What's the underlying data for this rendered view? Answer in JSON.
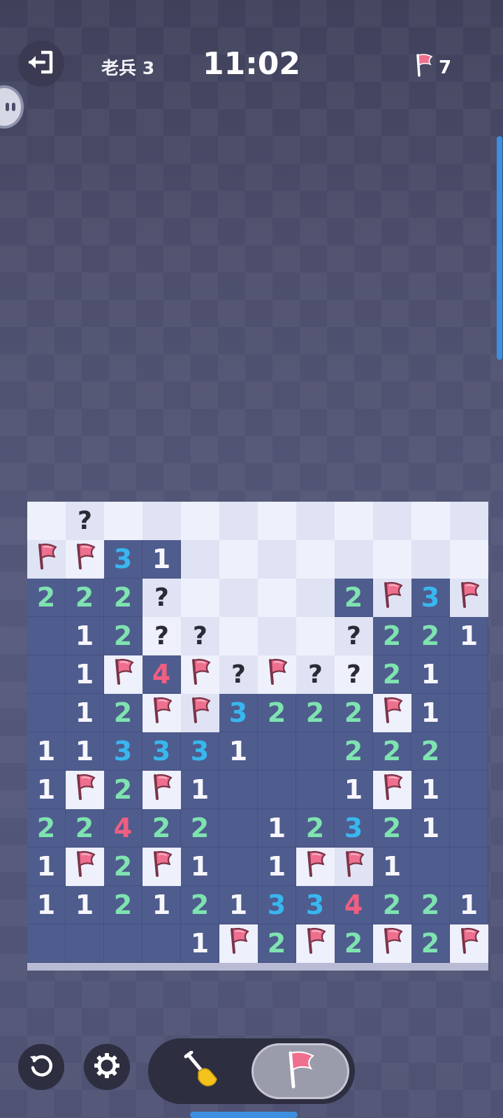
{
  "header": {
    "level": "老兵 3",
    "timer": "11:02",
    "flags_remaining": "7"
  },
  "icons": {
    "exit": "exit-icon",
    "flag": "flag-icon",
    "undo": "undo-icon",
    "settings": "gear-icon",
    "shovel": "shovel-icon"
  },
  "colors": {
    "num1": "#f6f6fb",
    "num2": "#7ee3b0",
    "num3": "#38b7ef",
    "num4": "#ef5f82",
    "flag": "#ef6f8e"
  },
  "tools": {
    "selected": "flag"
  },
  "board": {
    "rows": [
      [
        "H",
        "?",
        "H",
        "H",
        "H",
        "H",
        "H",
        "H",
        "H",
        "H",
        "H",
        "H"
      ],
      [
        "F",
        "F",
        "3",
        "1",
        "H",
        "H",
        "H",
        "H",
        "H",
        "H",
        "H",
        "H"
      ],
      [
        "2",
        "2",
        "2",
        "?",
        "H",
        "H",
        "H",
        "H",
        "2",
        "F",
        "3",
        "F"
      ],
      [
        "0",
        "1",
        "2",
        "?",
        "?",
        "H",
        "H",
        "H",
        "?",
        "2",
        "2",
        "1"
      ],
      [
        "0",
        "1",
        "F",
        "4",
        "F",
        "?",
        "F",
        "?",
        "?",
        "2",
        "1",
        "0"
      ],
      [
        "0",
        "1",
        "2",
        "F",
        "F",
        "3",
        "2",
        "2",
        "2",
        "F",
        "1",
        "0"
      ],
      [
        "1",
        "1",
        "3",
        "3",
        "3",
        "1",
        "0",
        "0",
        "2",
        "2",
        "2",
        "0"
      ],
      [
        "1",
        "F",
        "2",
        "F",
        "1",
        "0",
        "0",
        "0",
        "1",
        "F",
        "1",
        "0"
      ],
      [
        "2",
        "2",
        "4",
        "2",
        "2",
        "0",
        "1",
        "2",
        "3",
        "2",
        "1",
        "0"
      ],
      [
        "1",
        "F",
        "2",
        "F",
        "1",
        "0",
        "1",
        "F",
        "F",
        "1",
        "0",
        "0"
      ],
      [
        "1",
        "1",
        "2",
        "1",
        "2",
        "1",
        "3",
        "3",
        "4",
        "2",
        "2",
        "1"
      ],
      [
        "0",
        "0",
        "0",
        "0",
        "1",
        "F",
        "2",
        "F",
        "2",
        "F",
        "2",
        "F"
      ]
    ]
  }
}
